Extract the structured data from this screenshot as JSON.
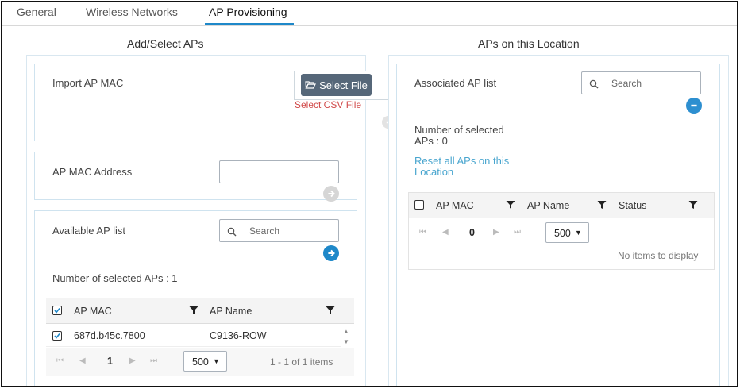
{
  "tabs": [
    {
      "label": "General"
    },
    {
      "label": "Wireless Networks"
    },
    {
      "label": "AP Provisioning"
    }
  ],
  "active_tab_color": "#1e88c9",
  "add_select": {
    "title": "Add/Select APs",
    "import": {
      "label": "Import AP MAC",
      "button_label": "Select File",
      "button_icon": "folder-open-icon",
      "hint": "Select CSV File"
    },
    "mac_address": {
      "label": "AP MAC Address",
      "value": "",
      "submit_icon": "arrow-right-circle-icon"
    },
    "available": {
      "label": "Available AP list",
      "search_placeholder": "Search",
      "add_icon": "arrow-right-circle-icon",
      "selected_count_text": "Number of selected APs : 1",
      "columns": [
        "AP MAC",
        "AP Name"
      ],
      "rows": [
        {
          "mac": "687d.b45c.7800",
          "name": "C9136-ROW",
          "checked": true
        }
      ],
      "page": "1",
      "page_size": "500",
      "range_text": "1 - 1 of 1 items"
    }
  },
  "location": {
    "title": "APs on this Location",
    "associated_label": "Associated AP list",
    "search_placeholder": "Search",
    "remove_icon": "minus-circle-icon",
    "selected_line1": "Number of selected",
    "selected_line2": "APs : 0",
    "reset_link": "Reset all APs on this Location",
    "columns": [
      "AP MAC",
      "AP Name",
      "Status"
    ],
    "page": "0",
    "page_size": "500",
    "empty_text": "No items to display"
  }
}
